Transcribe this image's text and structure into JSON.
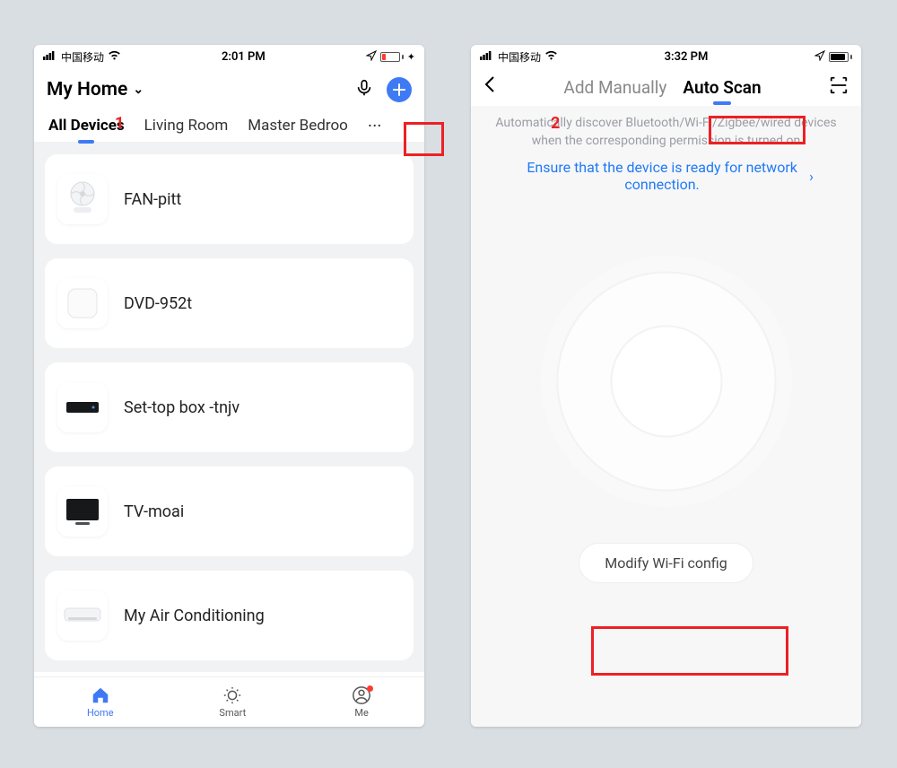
{
  "annotations": {
    "label1": "1",
    "label2": "2"
  },
  "phone1": {
    "status": {
      "carrier": "中国移动",
      "time": "2:01 PM"
    },
    "header": {
      "title": "My Home"
    },
    "tabs": {
      "items": [
        {
          "label": "All Devices"
        },
        {
          "label": "Living Room"
        },
        {
          "label": "Master Bedroo"
        }
      ],
      "more": "···"
    },
    "devices": [
      {
        "name": "FAN-pitt",
        "icon": "fan"
      },
      {
        "name": "DVD-952t",
        "icon": "square"
      },
      {
        "name": "Set-top box -tnjv",
        "icon": "settop"
      },
      {
        "name": "TV-moai",
        "icon": "tv"
      },
      {
        "name": "My Air Conditioning",
        "icon": "ac"
      }
    ],
    "nav": {
      "home": "Home",
      "smart": "Smart",
      "me": "Me"
    }
  },
  "phone2": {
    "status": {
      "carrier": "中国移动",
      "time": "3:32 PM"
    },
    "tabs": {
      "manual": "Add Manually",
      "auto": "Auto Scan"
    },
    "info": "Automatically discover Bluetooth/Wi-Fi/Zigbee/wired devices when the corresponding permission is turned on",
    "link": "Ensure that the device is ready for network connection.",
    "wifi_button": "Modify Wi-Fi config"
  }
}
